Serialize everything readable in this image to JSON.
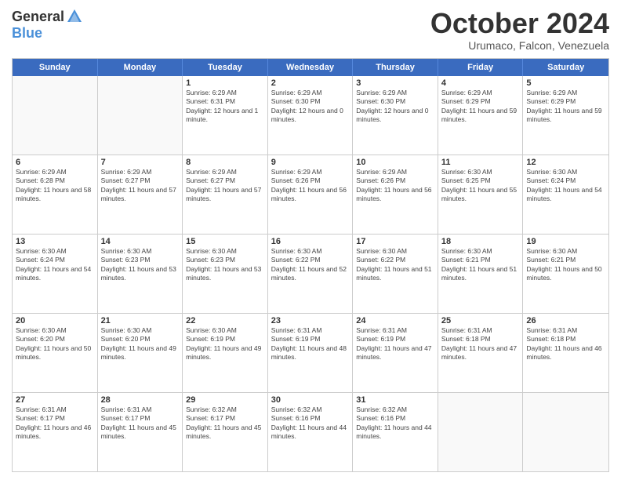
{
  "logo": {
    "general": "General",
    "blue": "Blue"
  },
  "header": {
    "month": "October 2024",
    "location": "Urumaco, Falcon, Venezuela"
  },
  "weekdays": [
    "Sunday",
    "Monday",
    "Tuesday",
    "Wednesday",
    "Thursday",
    "Friday",
    "Saturday"
  ],
  "weeks": [
    [
      {
        "day": "",
        "empty": true
      },
      {
        "day": "",
        "empty": true
      },
      {
        "day": "1",
        "sunrise": "6:29 AM",
        "sunset": "6:31 PM",
        "daylight": "12 hours and 1 minute."
      },
      {
        "day": "2",
        "sunrise": "6:29 AM",
        "sunset": "6:30 PM",
        "daylight": "12 hours and 0 minutes."
      },
      {
        "day": "3",
        "sunrise": "6:29 AM",
        "sunset": "6:30 PM",
        "daylight": "12 hours and 0 minutes."
      },
      {
        "day": "4",
        "sunrise": "6:29 AM",
        "sunset": "6:29 PM",
        "daylight": "11 hours and 59 minutes."
      },
      {
        "day": "5",
        "sunrise": "6:29 AM",
        "sunset": "6:29 PM",
        "daylight": "11 hours and 59 minutes."
      }
    ],
    [
      {
        "day": "6",
        "sunrise": "6:29 AM",
        "sunset": "6:28 PM",
        "daylight": "11 hours and 58 minutes."
      },
      {
        "day": "7",
        "sunrise": "6:29 AM",
        "sunset": "6:27 PM",
        "daylight": "11 hours and 57 minutes."
      },
      {
        "day": "8",
        "sunrise": "6:29 AM",
        "sunset": "6:27 PM",
        "daylight": "11 hours and 57 minutes."
      },
      {
        "day": "9",
        "sunrise": "6:29 AM",
        "sunset": "6:26 PM",
        "daylight": "11 hours and 56 minutes."
      },
      {
        "day": "10",
        "sunrise": "6:29 AM",
        "sunset": "6:26 PM",
        "daylight": "11 hours and 56 minutes."
      },
      {
        "day": "11",
        "sunrise": "6:30 AM",
        "sunset": "6:25 PM",
        "daylight": "11 hours and 55 minutes."
      },
      {
        "day": "12",
        "sunrise": "6:30 AM",
        "sunset": "6:24 PM",
        "daylight": "11 hours and 54 minutes."
      }
    ],
    [
      {
        "day": "13",
        "sunrise": "6:30 AM",
        "sunset": "6:24 PM",
        "daylight": "11 hours and 54 minutes."
      },
      {
        "day": "14",
        "sunrise": "6:30 AM",
        "sunset": "6:23 PM",
        "daylight": "11 hours and 53 minutes."
      },
      {
        "day": "15",
        "sunrise": "6:30 AM",
        "sunset": "6:23 PM",
        "daylight": "11 hours and 53 minutes."
      },
      {
        "day": "16",
        "sunrise": "6:30 AM",
        "sunset": "6:22 PM",
        "daylight": "11 hours and 52 minutes."
      },
      {
        "day": "17",
        "sunrise": "6:30 AM",
        "sunset": "6:22 PM",
        "daylight": "11 hours and 51 minutes."
      },
      {
        "day": "18",
        "sunrise": "6:30 AM",
        "sunset": "6:21 PM",
        "daylight": "11 hours and 51 minutes."
      },
      {
        "day": "19",
        "sunrise": "6:30 AM",
        "sunset": "6:21 PM",
        "daylight": "11 hours and 50 minutes."
      }
    ],
    [
      {
        "day": "20",
        "sunrise": "6:30 AM",
        "sunset": "6:20 PM",
        "daylight": "11 hours and 50 minutes."
      },
      {
        "day": "21",
        "sunrise": "6:30 AM",
        "sunset": "6:20 PM",
        "daylight": "11 hours and 49 minutes."
      },
      {
        "day": "22",
        "sunrise": "6:30 AM",
        "sunset": "6:19 PM",
        "daylight": "11 hours and 49 minutes."
      },
      {
        "day": "23",
        "sunrise": "6:31 AM",
        "sunset": "6:19 PM",
        "daylight": "11 hours and 48 minutes."
      },
      {
        "day": "24",
        "sunrise": "6:31 AM",
        "sunset": "6:19 PM",
        "daylight": "11 hours and 47 minutes."
      },
      {
        "day": "25",
        "sunrise": "6:31 AM",
        "sunset": "6:18 PM",
        "daylight": "11 hours and 47 minutes."
      },
      {
        "day": "26",
        "sunrise": "6:31 AM",
        "sunset": "6:18 PM",
        "daylight": "11 hours and 46 minutes."
      }
    ],
    [
      {
        "day": "27",
        "sunrise": "6:31 AM",
        "sunset": "6:17 PM",
        "daylight": "11 hours and 46 minutes."
      },
      {
        "day": "28",
        "sunrise": "6:31 AM",
        "sunset": "6:17 PM",
        "daylight": "11 hours and 45 minutes."
      },
      {
        "day": "29",
        "sunrise": "6:32 AM",
        "sunset": "6:17 PM",
        "daylight": "11 hours and 45 minutes."
      },
      {
        "day": "30",
        "sunrise": "6:32 AM",
        "sunset": "6:16 PM",
        "daylight": "11 hours and 44 minutes."
      },
      {
        "day": "31",
        "sunrise": "6:32 AM",
        "sunset": "6:16 PM",
        "daylight": "11 hours and 44 minutes."
      },
      {
        "day": "",
        "empty": true
      },
      {
        "day": "",
        "empty": true
      }
    ]
  ]
}
